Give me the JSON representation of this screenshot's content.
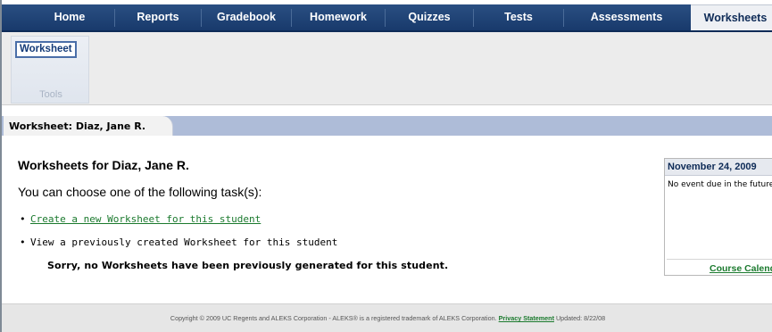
{
  "nav": {
    "tabs": [
      {
        "label": "Home"
      },
      {
        "label": "Reports"
      },
      {
        "label": "Gradebook"
      },
      {
        "label": "Homework"
      },
      {
        "label": "Quizzes"
      },
      {
        "label": "Tests"
      },
      {
        "label": "Assessments"
      },
      {
        "label": "Worksheets",
        "active": true
      }
    ]
  },
  "tools": {
    "button_label": "Worksheet",
    "group_label": "Tools"
  },
  "page_tab": {
    "label": "Worksheet: Diaz, Jane R."
  },
  "main": {
    "heading": "Worksheets for Diaz, Jane R.",
    "intro": "You can choose one of the following task(s):",
    "tasks": [
      {
        "label": "Create a new Worksheet for this student",
        "link": true
      },
      {
        "label": "View a previously created Worksheet for this student",
        "link": false
      }
    ],
    "message": "Sorry, no Worksheets have been previously generated for this student."
  },
  "calendar": {
    "date": "November 24, 2009",
    "text": "No event due in the future",
    "link": "Course Calend"
  },
  "footer": {
    "copyright": "Copyright © 2009 UC Regents and ALEKS Corporation - ALEKS® is a registered trademark of ALEKS Corporation.",
    "privacy_link": "Privacy Statement",
    "updated": "Updated: 8/22/08"
  },
  "colors": {
    "nav_bg": "#17386a",
    "link_green": "#1b7a2e",
    "strip_blue": "#aebcd8"
  }
}
